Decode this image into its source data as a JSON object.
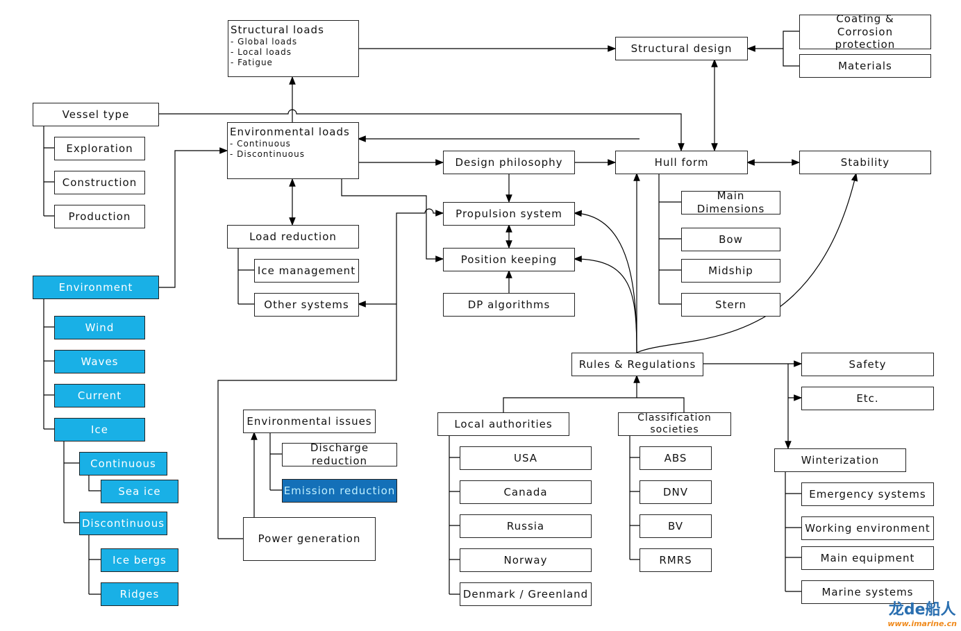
{
  "nodes": {
    "structural_loads": {
      "title": "Structural loads",
      "items": [
        "- Global loads",
        "- Local loads",
        "- Fatigue"
      ]
    },
    "environmental_loads": {
      "title": "Environmental loads",
      "items": [
        "- Continuous",
        "- Discontinuous"
      ]
    },
    "vessel_type": "Vessel type",
    "exploration": "Exploration",
    "construction": "Construction",
    "production": "Production",
    "environment": "Environment",
    "wind": "Wind",
    "waves": "Waves",
    "current": "Current",
    "ice": "Ice",
    "continuous": "Continuous",
    "sea_ice": "Sea ice",
    "discontinuous": "Discontinuous",
    "ice_bergs": "Ice bergs",
    "ridges": "Ridges",
    "load_reduction": "Load reduction",
    "ice_management": "Ice management",
    "other_systems": "Other systems",
    "design_philosophy": "Design philosophy",
    "propulsion_system": "Propulsion system",
    "position_keeping": "Position keeping",
    "dp_algorithms": "DP algorithms",
    "structural_design": "Structural design",
    "coating": "Coating & Corrosion protection",
    "materials": "Materials",
    "hull_form": "Hull form",
    "stability": "Stability",
    "main_dimensions": "Main Dimensions",
    "bow": "Bow",
    "midship": "Midship",
    "stern": "Stern",
    "rules": "Rules & Regulations",
    "safety": "Safety",
    "etc": "Etc.",
    "winterization": "Winterization",
    "emergency_systems": "Emergency systems",
    "working_environment": "Working environment",
    "main_equipment": "Main equipment",
    "marine_systems": "Marine systems",
    "local_authorities": "Local authorities",
    "usa": "USA",
    "canada": "Canada",
    "russia": "Russia",
    "norway": "Norway",
    "denmark": "Denmark / Greenland",
    "classification_societies": "Classification societies",
    "abs": "ABS",
    "dnv": "DNV",
    "bv": "BV",
    "rmrs": "RMRS",
    "environmental_issues": "Environmental issues",
    "discharge_reduction": "Discharge reduction",
    "emission_reduction": "Emission reduction",
    "power_generation": "Power generation"
  },
  "colors": {
    "environment_fill": "#19b0e6",
    "emission_fill": "#1470b8"
  },
  "watermark": {
    "logo": "龙de船人",
    "url": "www.imarine.cn"
  }
}
